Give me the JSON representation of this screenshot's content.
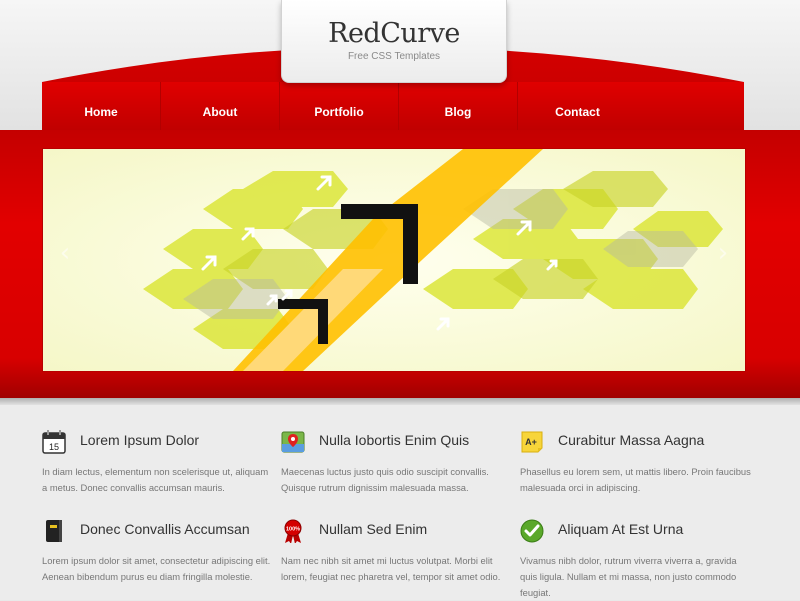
{
  "header": {
    "logo_title": "RedCurve",
    "logo_subtitle": "Free CSS Templates"
  },
  "nav": {
    "items": [
      {
        "label": "Home"
      },
      {
        "label": "About"
      },
      {
        "label": "Portfolio"
      },
      {
        "label": "Blog"
      },
      {
        "label": "Contact"
      }
    ]
  },
  "slider": {
    "prev_icon": "chevron-left-icon",
    "next_icon": "chevron-right-icon"
  },
  "features": [
    {
      "title": "Lorem Ipsum Dolor",
      "icon": "calendar-icon",
      "icon_text": "15",
      "text": "In diam lectus, elementum non scelerisque ut, aliquam a metus. Donec convallis accumsan mauris."
    },
    {
      "title": "Nulla Iobortis Enim Quis",
      "icon": "map-icon",
      "text": "Maecenas luctus justo quis odio suscipit convallis. Quisque rutrum dignissim malesuada massa."
    },
    {
      "title": "Curabitur Massa Aagna",
      "icon": "grade-note-icon",
      "icon_text": "A+",
      "text": "Phasellus eu lorem sem, ut mattis libero. Proin faucibus malesuada orci in adipiscing."
    },
    {
      "title": "Donec Convallis Accumsan",
      "icon": "notebook-icon",
      "text": "Lorem ipsum dolor sit amet, consectetur adipiscing elit. Aenean bibendum purus eu diam fringilla molestie."
    },
    {
      "title": "Nullam Sed Enim",
      "icon": "award-badge-icon",
      "icon_text": "100%",
      "text": "Nam nec nibh sit amet mi luctus volutpat. Morbi elit lorem, feugiat nec pharetra vel, tempor sit amet odio."
    },
    {
      "title": "Aliquam At Est Urna",
      "icon": "checkmark-icon",
      "text": "Vivamus nibh dolor, rutrum viverra viverra a, gravida quis ligula. Nullam et mi massa, non justo commodo feugiat."
    }
  ],
  "colors": {
    "brand_red": "#d80000",
    "banner_yellow": "#e6ee3a",
    "banner_orange": "#ffc400"
  }
}
